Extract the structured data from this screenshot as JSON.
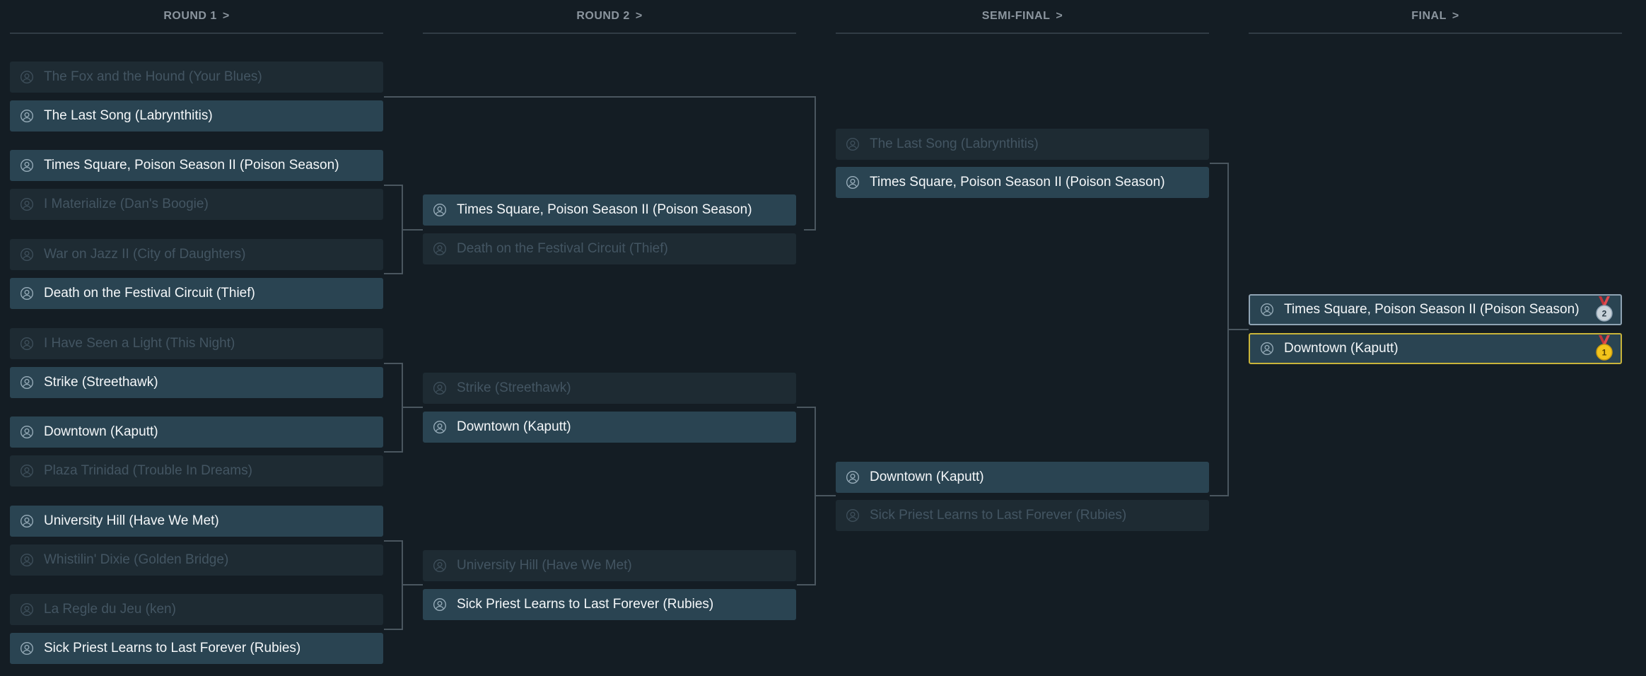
{
  "rounds": [
    {
      "label": "ROUND 1",
      "chevron": ">"
    },
    {
      "label": "ROUND 2",
      "chevron": ">"
    },
    {
      "label": "SEMI-FINAL",
      "chevron": ">"
    },
    {
      "label": "FINAL",
      "chevron": ">"
    }
  ],
  "round1": [
    "The Fox and the Hound (Your Blues)",
    "The Last Song (Labrynthitis)",
    "Times Square, Poison Season II (Poison Season)",
    "I Materialize (Dan's Boogie)",
    "War on Jazz II (City of Daughters)",
    "Death on the Festival Circuit (Thief)",
    "I Have Seen a Light (This Night)",
    "Strike (Streethawk)",
    "Downtown (Kaputt)",
    "Plaza Trinidad (Trouble In Dreams)",
    "University Hill (Have We Met)",
    "Whistilin' Dixie (Golden Bridge)",
    "La Regle du Jeu (ken)",
    "Sick Priest Learns to Last Forever (Rubies)"
  ],
  "round2": [
    "Times Square, Poison Season II (Poison Season)",
    "Death on the Festival Circuit (Thief)",
    "Strike (Streethawk)",
    "Downtown (Kaputt)",
    "University Hill (Have We Met)",
    "Sick Priest Learns to Last Forever (Rubies)"
  ],
  "semifinal": [
    "The Last Song (Labrynthitis)",
    "Times Square, Poison Season II (Poison Season)",
    "Downtown (Kaputt)",
    "Sick Priest Learns to Last Forever (Rubies)"
  ],
  "final": [
    {
      "title": "Times Square, Poison Season II (Poison Season)",
      "medal": "2"
    },
    {
      "title": "Downtown (Kaputt)",
      "medal": "1"
    }
  ],
  "colors": {
    "background": "#141d24",
    "winner": "#2a4452",
    "loser": "#1e2b33",
    "silver": "#8fa3b3",
    "gold": "#f2c41b",
    "ribbon": "#c0353a"
  },
  "icons": {
    "entry": "user-circle-icon",
    "first": "gold-medal-icon",
    "second": "silver-medal-icon"
  }
}
